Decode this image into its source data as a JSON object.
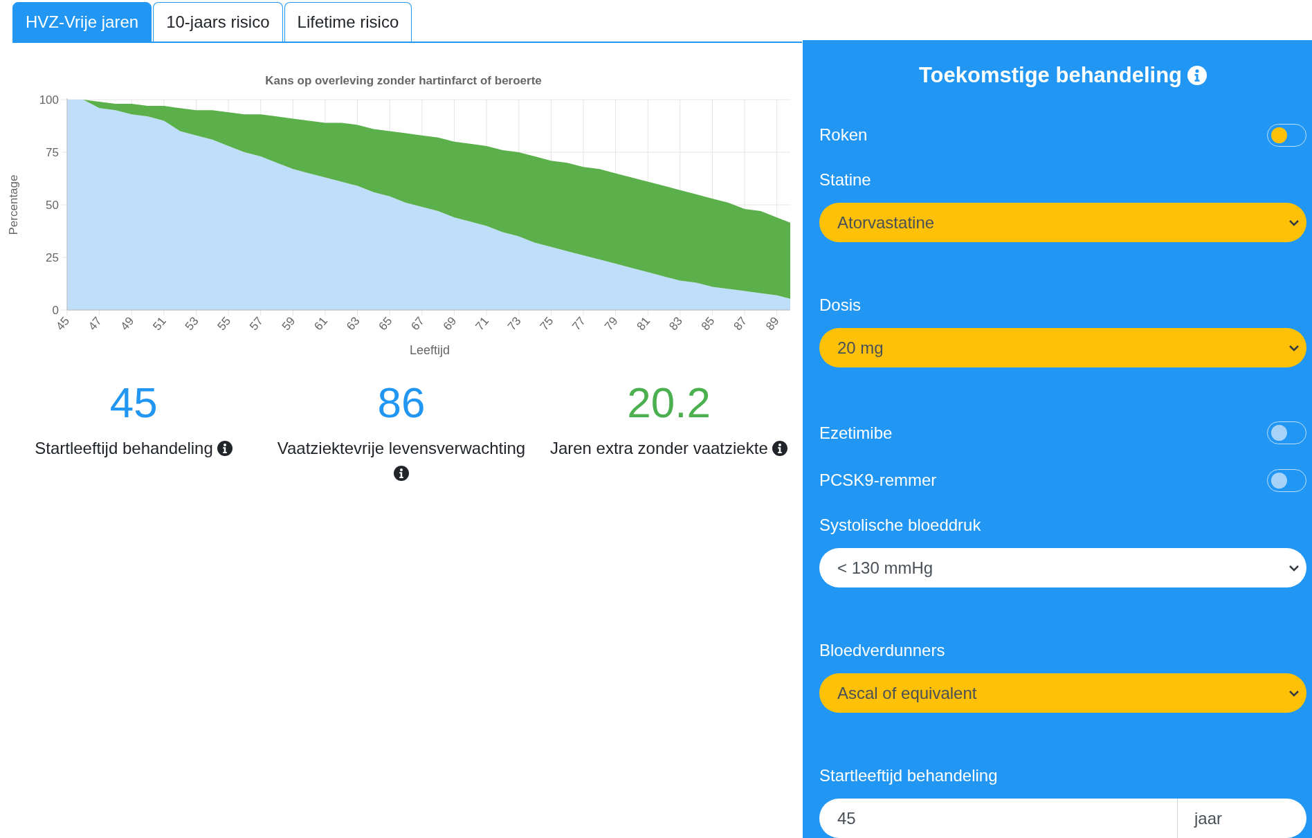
{
  "tabs": [
    {
      "label": "HVZ-Vrije jaren",
      "selected": true
    },
    {
      "label": "10-jaars risico",
      "selected": false
    },
    {
      "label": "Lifetime risico",
      "selected": false
    }
  ],
  "chart": {
    "chart_data": {
      "type": "area",
      "title": "Kans op overleving zonder hartinfarct of beroerte",
      "xlabel": "Leeftijd",
      "ylabel": "Percentage",
      "x": [
        45,
        46,
        47,
        48,
        49,
        50,
        51,
        52,
        53,
        54,
        55,
        56,
        57,
        58,
        59,
        60,
        61,
        62,
        63,
        64,
        65,
        66,
        67,
        68,
        69,
        70,
        71,
        72,
        73,
        74,
        75,
        76,
        77,
        78,
        79,
        80,
        81,
        82,
        83,
        84,
        85,
        86,
        87,
        88,
        89,
        90
      ],
      "series": [
        {
          "color": "#bfdefa",
          "values": [
            100,
            100,
            96,
            95,
            93,
            92,
            90,
            85,
            83,
            81,
            78,
            75,
            73,
            70,
            67,
            65,
            63,
            61,
            59,
            56,
            54,
            51,
            49,
            47,
            44,
            42,
            40,
            37,
            35,
            32,
            30,
            28,
            26,
            24,
            22,
            20,
            18,
            16,
            14,
            13,
            11,
            10,
            9,
            8,
            7,
            5
          ]
        },
        {
          "color": "#5bb04c",
          "values": [
            0,
            0,
            3,
            3,
            5,
            5,
            7,
            11,
            12,
            14,
            16,
            18,
            20,
            22,
            24,
            25,
            26,
            28,
            29,
            30,
            31,
            33,
            34,
            35,
            36,
            37,
            38,
            39,
            40,
            41,
            41,
            42,
            42,
            43,
            43,
            43,
            43,
            43,
            43,
            42,
            42,
            41,
            39,
            39,
            37,
            36
          ]
        }
      ],
      "xticks": [
        45,
        47,
        49,
        51,
        53,
        55,
        57,
        59,
        61,
        63,
        65,
        67,
        69,
        71,
        73,
        75,
        77,
        79,
        81,
        83,
        85,
        87,
        89
      ],
      "yticks": [
        0,
        25,
        50,
        75,
        100
      ],
      "xlim": [
        45,
        90
      ],
      "ylim": [
        0,
        100
      ],
      "grid": true,
      "stacked": true
    }
  },
  "stats": [
    {
      "value": "45",
      "label": "Startleeftijd behandeling",
      "color": "#2196f3"
    },
    {
      "value": "86",
      "label": "Vaatziektevrije levensverwachting",
      "color": "#2196f3"
    },
    {
      "value": "20.2",
      "label": "Jaren extra zonder vaatziekte",
      "color": "#4caf50"
    }
  ],
  "panel": {
    "title": "Toekomstige behandeling",
    "controls": [
      {
        "kind": "toggle",
        "label": "Roken",
        "on": false,
        "color": "#ffc107"
      },
      {
        "kind": "select",
        "label": "Statine",
        "value": "Atorvastatine",
        "highlighted": true
      },
      {
        "kind": "select",
        "label": "Dosis",
        "value": "20 mg",
        "highlighted": true
      },
      {
        "kind": "toggle",
        "label": "Ezetimibe",
        "on": false,
        "color": "#a8d3f8"
      },
      {
        "kind": "toggle",
        "label": "PCSK9-remmer",
        "on": false,
        "color": "#a8d3f8"
      },
      {
        "kind": "select",
        "label": "Systolische bloeddruk",
        "value": "< 130 mmHg",
        "highlighted": false
      },
      {
        "kind": "select",
        "label": "Bloedverdunners",
        "value": "Ascal of equivalent",
        "highlighted": true
      },
      {
        "kind": "input",
        "label": "Startleeftijd behandeling",
        "value": "45",
        "addon": "jaar"
      }
    ]
  }
}
